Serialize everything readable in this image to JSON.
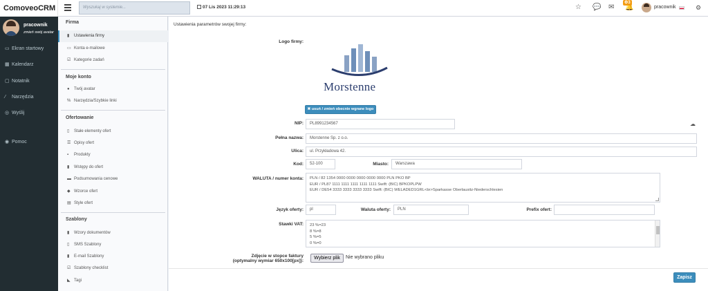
{
  "app": {
    "brand": "ComoveoCRM"
  },
  "header": {
    "search_placeholder": "Wyszukaj w systemie...",
    "datetime": "07 Lis 2023 11:29:13",
    "notifications_count": "3",
    "user_name": "pracownik"
  },
  "sidebar": {
    "user_name": "pracownik",
    "change_avatar": "zmień swój avatar",
    "items": [
      {
        "label": "Ekran startowy",
        "icon": "monitor-icon"
      },
      {
        "label": "Kalendarz",
        "icon": "calendar-icon"
      },
      {
        "label": "Notatnik",
        "icon": "notepad-icon"
      },
      {
        "label": "Narzędzia",
        "icon": "wrench-icon"
      },
      {
        "label": "Wyślij",
        "icon": "send-icon"
      },
      {
        "label": "Pomoc",
        "icon": "help-icon"
      }
    ]
  },
  "subnav": {
    "sections": [
      {
        "title": "Firma",
        "items": [
          "Ustawienia firmy",
          "Konta e-mailowe",
          "Kategorie zadań"
        ]
      },
      {
        "title": "Moje konto",
        "items": [
          "Twój avatar",
          "Narzędzia/Szybkie linki"
        ]
      },
      {
        "title": "Ofertowanie",
        "items": [
          "Stałe elementy ofert",
          "Opisy ofert",
          "Produkty",
          "Wstępy do ofert",
          "Podsumowania cenowe",
          "Wzorce ofert",
          "Style ofert"
        ]
      },
      {
        "title": "Szablony",
        "items": [
          "Wzory dokumentów",
          "SMS Szablony",
          "E-mail Szablony",
          "Szablony checklist",
          "Tagi"
        ]
      }
    ],
    "active": "Ustawienia firmy"
  },
  "form": {
    "title": "Ustawienia parametrów swojej firmy:",
    "logo_label": "Logo firmy:",
    "logo_text": "Morstenne",
    "remove_logo_button": "✖ usuń / zmień obecnie wgrane logo",
    "nip_label": "NIP:",
    "nip_value": "PL8991234567",
    "fullname_label": "Pełna nazwa:",
    "fullname_value": "Morstenne Sp. z o.o.",
    "street_label": "Ulica:",
    "street_value": "ul. Przykładowa 42.",
    "postcode_label": "Kod:",
    "postcode_value": "52-100",
    "city_label": "Miasto:",
    "city_value": "Warszawa",
    "currency_account_label": "WALUTA / numer konta:",
    "currency_account_lines": [
      "PLN / 82 1354 0000 0000 0000 0000 0000 PLN PKO BP",
      "EUR / PL87 1111 1111 1111 1111 1111 Swift: (BIC) BPKOPLPW",
      "EUR / DE54 3333 3333 3333 3333 Swift: (BIC) WELADED1GRL<br>Sparkasse Oberlausitz-Niederschlesien"
    ],
    "offer_lang_label": "Język oferty:",
    "offer_lang_value": "pl",
    "offer_currency_label": "Waluta oferty:",
    "offer_currency_value": "PLN",
    "offer_prefix_label": "Prefix ofert:",
    "offer_prefix_value": "",
    "vat_label": "Stawki VAT:",
    "vat_lines": [
      "23 %=23",
      "8 %=8",
      "5 %=5",
      "0 %=0"
    ],
    "footer_photo_label_1": "Zdjęcie w stopce faktury",
    "footer_photo_label_2": "(optymalny wymiar 650x100[px]):",
    "file_button": "Wybierz plik",
    "file_status": "Nie wybrano pliku",
    "save_button": "Zapisz"
  }
}
